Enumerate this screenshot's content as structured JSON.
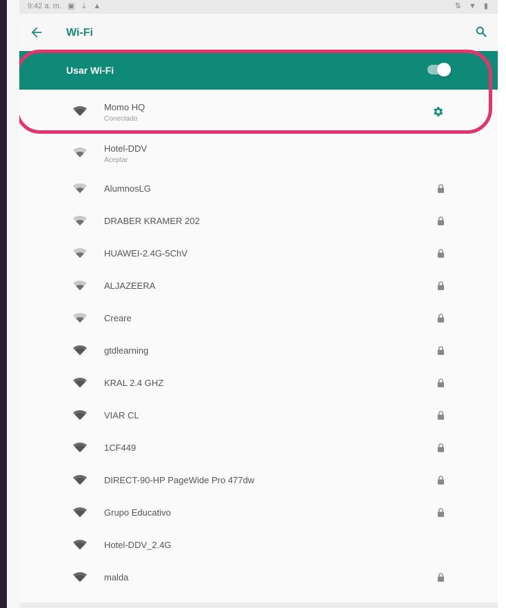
{
  "status_bar": {
    "time": "9:42 a. m.",
    "left_icons": "▣ ⤓ ▲",
    "right_icons": "⇅ ▼ ▮"
  },
  "header": {
    "title": "Wi-Fi",
    "back_icon": "arrow-left-icon",
    "search_icon": "search-icon"
  },
  "wifi_toggle": {
    "label": "Usar Wi-Fi",
    "state": "on"
  },
  "colors": {
    "accent": "#0f8a79",
    "highlight": "#e3356b"
  },
  "networks": [
    {
      "name": "Momo HQ",
      "subtitle": "Conectado",
      "action": "settings"
    },
    {
      "name": "Hotel-DDV",
      "subtitle": "Aceptar",
      "action": "none"
    },
    {
      "name": "AlumnosLG",
      "subtitle": "",
      "action": "lock"
    },
    {
      "name": "DRABER KRAMER 202",
      "subtitle": "",
      "action": "lock"
    },
    {
      "name": "HUAWEI-2.4G-5ChV",
      "subtitle": "",
      "action": "lock"
    },
    {
      "name": "ALJAZEERA",
      "subtitle": "",
      "action": "lock"
    },
    {
      "name": "Creare",
      "subtitle": "",
      "action": "lock"
    },
    {
      "name": "gtdlearning",
      "subtitle": "",
      "action": "lock"
    },
    {
      "name": "KRAL 2.4 GHZ",
      "subtitle": "",
      "action": "lock"
    },
    {
      "name": "VIAR CL",
      "subtitle": "",
      "action": "lock"
    },
    {
      "name": "1CF449",
      "subtitle": "",
      "action": "lock"
    },
    {
      "name": "DIRECT-90-HP PageWide Pro 477dw",
      "subtitle": "",
      "action": "lock"
    },
    {
      "name": "Grupo Educativo",
      "subtitle": "",
      "action": "lock"
    },
    {
      "name": "Hotel-DDV_2.4G",
      "subtitle": "",
      "action": "none"
    },
    {
      "name": "malda",
      "subtitle": "",
      "action": "lock"
    }
  ]
}
